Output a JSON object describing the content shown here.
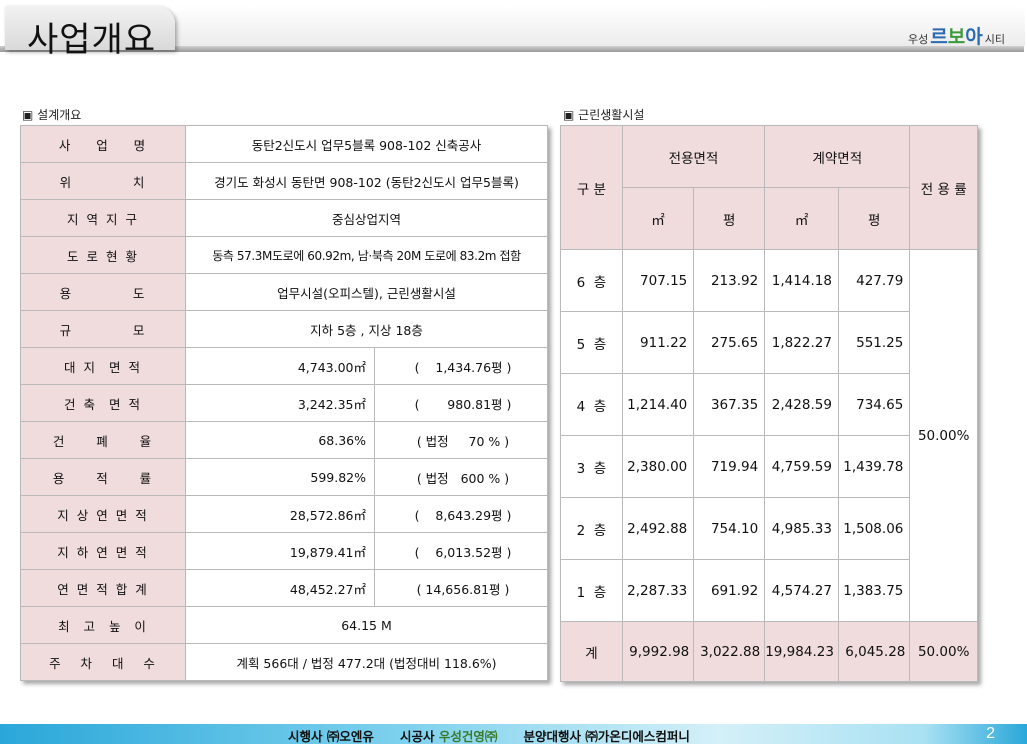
{
  "header": {
    "title": "사업개요",
    "logo": {
      "prefix": "우성",
      "part1": "르",
      "part2": "보",
      "part3": "아",
      "suffix": "시티"
    }
  },
  "design": {
    "section_label": "▣ 설계개요",
    "rows": [
      {
        "label": "사    업    명",
        "value": "동탄2신도시 업무5블록 908-102 신축공사"
      },
      {
        "label": "위          치",
        "value": "경기도 화성시 동탄면 908-102 (동탄2신도시 업무5블록)"
      },
      {
        "label": "지 역 지 구",
        "value": "중심상업지역"
      },
      {
        "label": "도 로 현 황",
        "value": "동측 57.3M도로에 60.92m, 남·북측 20M 도로에 83.2m 접함"
      },
      {
        "label": "용          도",
        "value": "업무시설(오피스텔), 근린생활시설"
      },
      {
        "label": "규          모",
        "value": "지하 5층 , 지상 18층"
      },
      {
        "label": "대 지  면 적",
        "value": "4,743.00㎡",
        "value2": "(    1,434.76평 )"
      },
      {
        "label": "건 축  면 적",
        "value": "3,242.35㎡",
        "value2": "(       980.81평 )"
      },
      {
        "label": "건     폐     율",
        "value": "68.36%",
        "value2": "( 법정     70 % )"
      },
      {
        "label": "용     적     률",
        "value": "599.82%",
        "value2": "( 법정   600 % )"
      },
      {
        "label": "지 상 연 면 적",
        "value": "28,572.86㎡",
        "value2": "(    8,643.29평 )"
      },
      {
        "label": "지 하 연 면 적",
        "value": "19,879.41㎡",
        "value2": "(    6,013.52평 )"
      },
      {
        "label": "연 면 적 합 계",
        "value": "48,452.27㎡",
        "value2": "( 14,656.81평 )"
      },
      {
        "label": "최  고  높  이",
        "value": "64.15 M"
      },
      {
        "label": "주   차   대   수",
        "value": "계획 566대 / 법정 477.2대 (법정대비 118.6%)"
      }
    ]
  },
  "retail": {
    "section_label": "▣ 근린생활시설",
    "header": {
      "category": "구  분",
      "exclusive_area": "전용면적",
      "contract_area": "계약면적",
      "ratio": "전 용 률",
      "unit_m2": "㎡",
      "unit_pyeong": "평"
    },
    "floors": [
      {
        "floor": "6  층",
        "ex_m2": "707.15",
        "ex_py": "213.92",
        "ct_m2": "1,414.18",
        "ct_py": "427.79"
      },
      {
        "floor": "5  층",
        "ex_m2": "911.22",
        "ex_py": "275.65",
        "ct_m2": "1,822.27",
        "ct_py": "551.25"
      },
      {
        "floor": "4  층",
        "ex_m2": "1,214.40",
        "ex_py": "367.35",
        "ct_m2": "2,428.59",
        "ct_py": "734.65"
      },
      {
        "floor": "3  층",
        "ex_m2": "2,380.00",
        "ex_py": "719.94",
        "ct_m2": "4,759.59",
        "ct_py": "1,439.78"
      },
      {
        "floor": "2  층",
        "ex_m2": "2,492.88",
        "ex_py": "754.10",
        "ct_m2": "4,985.33",
        "ct_py": "1,508.06"
      },
      {
        "floor": "1  층",
        "ex_m2": "2,287.33",
        "ex_py": "691.92",
        "ct_m2": "4,574.27",
        "ct_py": "1,383.75"
      }
    ],
    "floor_ratio": "50.00%",
    "total": {
      "label": "계",
      "ex_m2": "9,992.98",
      "ex_py": "3,022.88",
      "ct_m2": "19,984.23",
      "ct_py": "6,045.28",
      "ratio": "50.00%"
    }
  },
  "footer": {
    "developer_label": "시행사",
    "developer": "㈜오엔유",
    "builder_label": "시공사",
    "builder": "우성건영㈜",
    "agent_label": "분양대행사",
    "agent": "㈜가온디에스컴퍼니",
    "page_number": "2"
  }
}
